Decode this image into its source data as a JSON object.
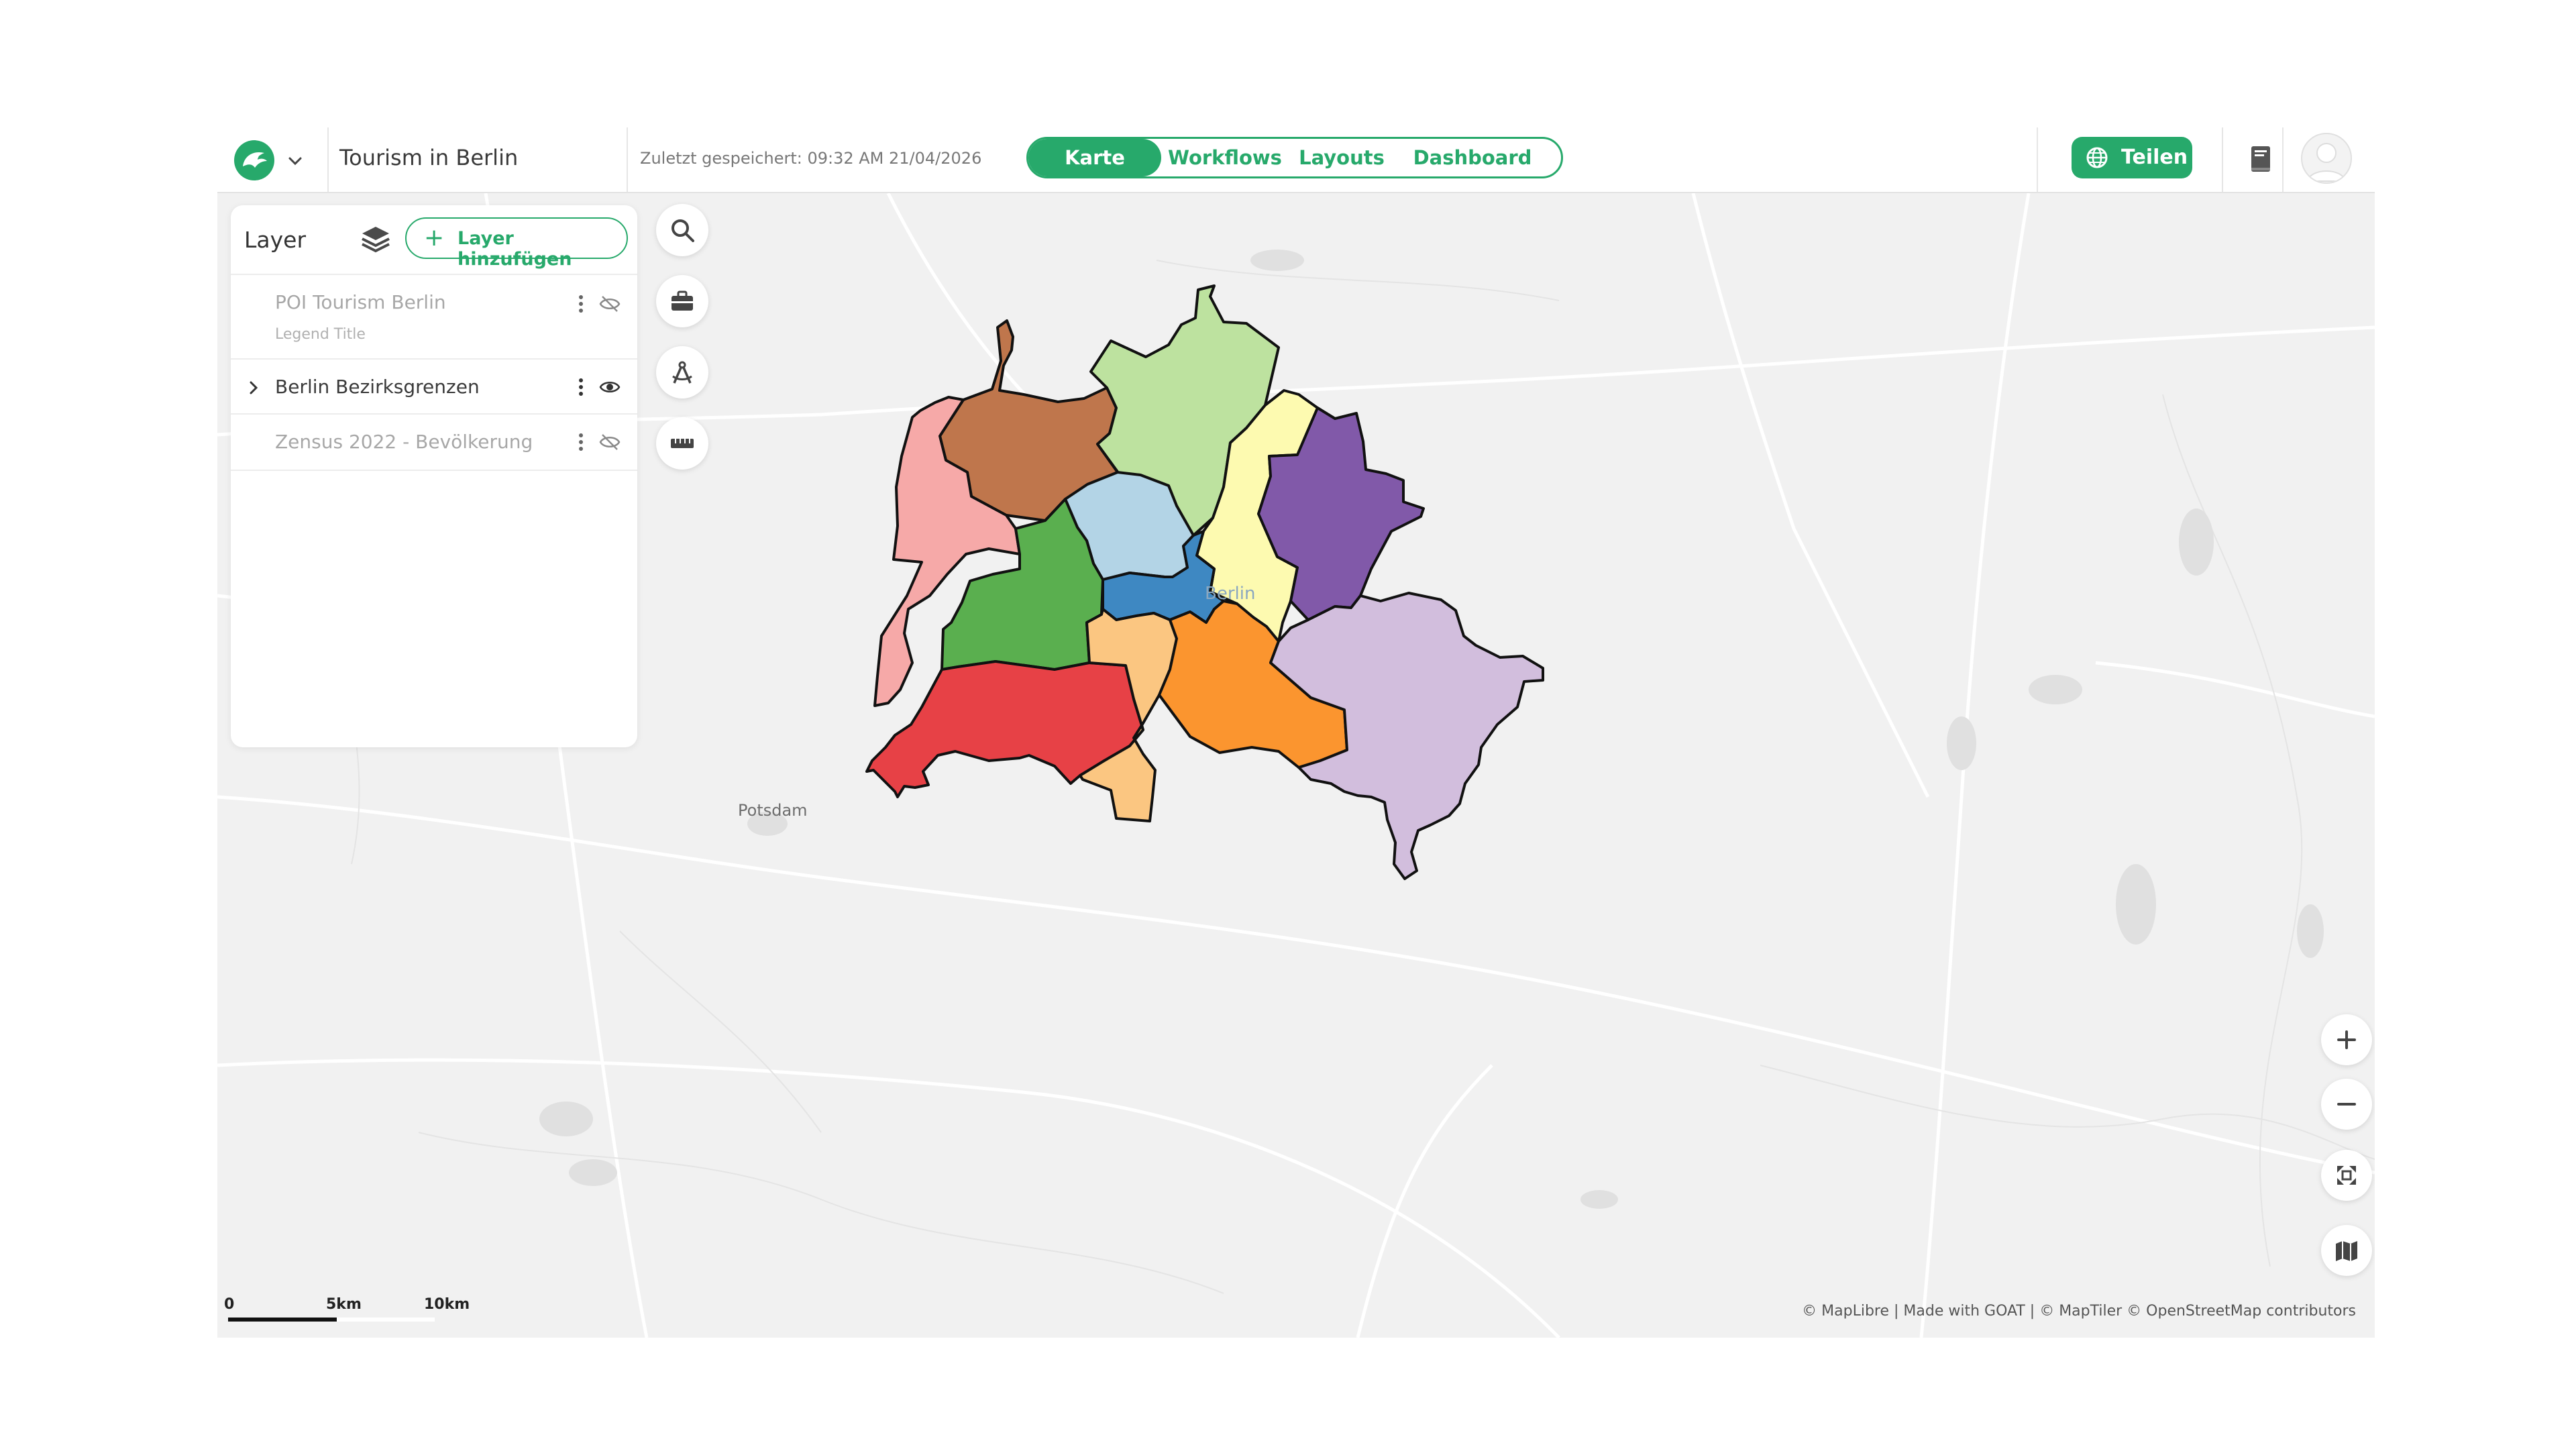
{
  "header": {
    "project_title": "Tourism in Berlin",
    "saved_text": "Zuletzt gespeichert: 09:32 AM 21/04/2026",
    "tabs": [
      {
        "label": "Karte",
        "active": true
      },
      {
        "label": "Workflows",
        "active": false
      },
      {
        "label": "Layouts",
        "active": false
      },
      {
        "label": "Dashboard",
        "active": false
      }
    ],
    "share_label": "Teilen",
    "accent_color": "#27a96b"
  },
  "layer_panel": {
    "title": "Layer",
    "add_label": "Layer hinzufügen",
    "layers": [
      {
        "name": "POI Tourism Berlin",
        "legend": "Legend Title",
        "visible": false
      },
      {
        "name": "Berlin Bezirksgrenzen",
        "visible": true
      },
      {
        "name": "Zensus 2022 - Bevölkerung",
        "visible": false
      }
    ]
  },
  "map": {
    "place_labels": {
      "berlin": "Berlin",
      "potsdam": "Potsdam"
    },
    "scale": {
      "labels": [
        "0",
        "5km",
        "10km"
      ]
    },
    "attribution": "© MapLibre | Made with GOAT | © MapTiler © OpenStreetMap contributors",
    "district_colors": [
      "#bf764c",
      "#bde29f",
      "#f6a9a8",
      "#fdfab0",
      "#b3d4e6",
      "#5aaf4f",
      "#3e88c2",
      "#8159a9",
      "#e74146",
      "#fbc681",
      "#fb952f",
      "#d2bedd"
    ]
  },
  "icons": [
    "goat-logo-icon",
    "chevron-down-icon",
    "globe-icon",
    "book-icon",
    "avatar-icon",
    "layers-icon",
    "plus-icon",
    "more-vert-icon",
    "eye-icon",
    "eye-off-icon",
    "chevron-right-icon",
    "search-icon",
    "toolbox-icon",
    "compass-icon",
    "ruler-icon",
    "zoom-in-icon",
    "zoom-out-icon",
    "fullscreen-icon",
    "basemap-icon"
  ]
}
